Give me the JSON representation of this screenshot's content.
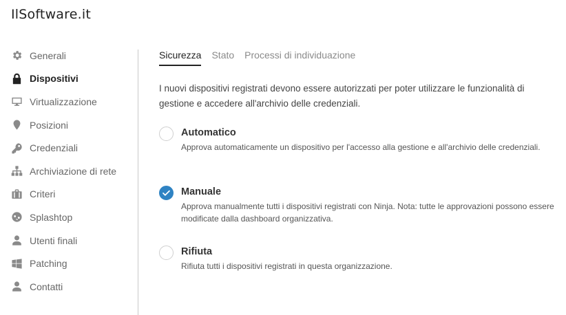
{
  "site": {
    "title": "IlSoftware.it"
  },
  "sidebar": {
    "items": [
      {
        "label": "Generali",
        "icon": "gear-icon"
      },
      {
        "label": "Dispositivi",
        "icon": "lock-icon",
        "active": true
      },
      {
        "label": "Virtualizzazione",
        "icon": "monitor-icon"
      },
      {
        "label": "Posizioni",
        "icon": "map-pin-icon"
      },
      {
        "label": "Credenziali",
        "icon": "key-icon"
      },
      {
        "label": "Archiviazione di rete",
        "icon": "network-icon"
      },
      {
        "label": "Criteri",
        "icon": "briefcase-icon"
      },
      {
        "label": "Splashtop",
        "icon": "splashtop-icon"
      },
      {
        "label": "Utenti finali",
        "icon": "user-icon"
      },
      {
        "label": "Patching",
        "icon": "windows-icon"
      },
      {
        "label": "Contatti",
        "icon": "contact-icon"
      }
    ]
  },
  "tabs": [
    {
      "label": "Sicurezza",
      "active": true
    },
    {
      "label": "Stato"
    },
    {
      "label": "Processi di individuazione"
    }
  ],
  "main": {
    "intro": "I nuovi dispositivi registrati devono essere autorizzati per poter utilizzare le funzionalità di gestione e accedere all'archivio delle credenziali.",
    "options": [
      {
        "title": "Automatico",
        "description": "Approva automaticamente un dispositivo per l'accesso alla gestione e all'archivio delle credenziali.",
        "selected": false
      },
      {
        "title": "Manuale",
        "description": "Approva manualmente tutti i dispositivi registrati con Ninja. Nota: tutte le approvazioni possono essere modificate dalla dashboard organizzativa.",
        "selected": true
      },
      {
        "title": "Rifiuta",
        "description": "Rifiuta tutti i dispositivi registrati in questa organizzazione.",
        "selected": false
      }
    ]
  },
  "colors": {
    "accent": "#2f83c3",
    "icon_inactive": "#8a8a8a",
    "text_active": "#222222"
  }
}
